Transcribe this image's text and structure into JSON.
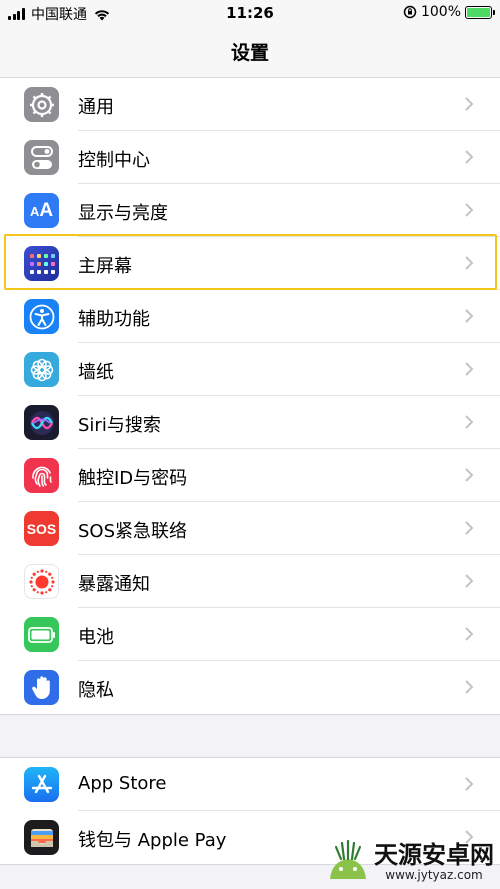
{
  "status": {
    "carrier": "中国联通",
    "time": "11:26",
    "battery_percent": "100%"
  },
  "nav": {
    "title": "设置"
  },
  "group1": [
    {
      "label": "通用",
      "icon": "gear-icon",
      "color": "#8e8e93"
    },
    {
      "label": "控制中心",
      "icon": "toggles-icon",
      "color": "#8e8e93"
    },
    {
      "label": "显示与亮度",
      "icon": "text-size-icon",
      "color": "#2f7bf6"
    },
    {
      "label": "主屏幕",
      "icon": "home-screen-icon",
      "color": "#2a3fb8"
    },
    {
      "label": "辅助功能",
      "icon": "accessibility-icon",
      "color": "#1a82f7"
    },
    {
      "label": "墙纸",
      "icon": "wallpaper-flower-icon",
      "color": "#36aadc"
    },
    {
      "label": "Siri与搜索",
      "icon": "siri-icon",
      "color": "#1b1b2e"
    },
    {
      "label": "触控ID与密码",
      "icon": "fingerprint-icon",
      "color": "#f0344e"
    },
    {
      "label": "SOS紧急联络",
      "icon": "sos-icon",
      "color": "#ee3a30"
    },
    {
      "label": "暴露通知",
      "icon": "exposure-icon",
      "color": "#ffffff"
    },
    {
      "label": "电池",
      "icon": "battery-icon",
      "color": "#35c759"
    },
    {
      "label": "隐私",
      "icon": "hand-icon",
      "color": "#2f6ee8"
    }
  ],
  "group2": [
    {
      "label": "App Store",
      "icon": "app-store-icon",
      "color": "#1d8df5"
    },
    {
      "label": "钱包与 Apple Pay",
      "icon": "wallet-icon",
      "color": "#1c1c1e"
    }
  ],
  "highlighted_item": "主屏幕",
  "watermark": {
    "text": "天源安卓网",
    "url": "www.jytyaz.com"
  }
}
